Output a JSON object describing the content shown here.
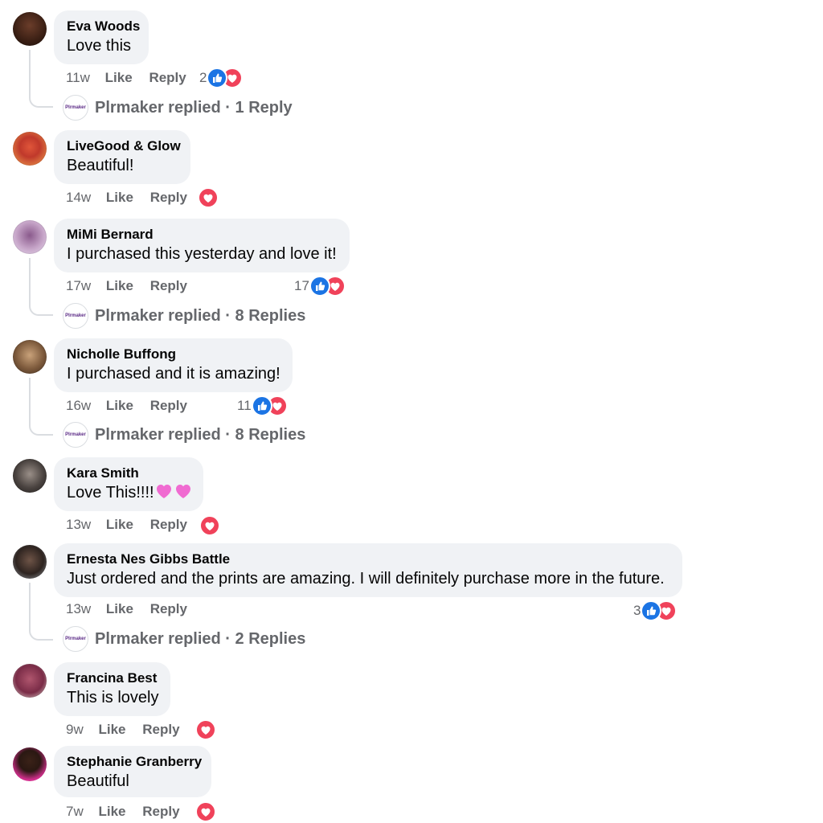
{
  "colors": {
    "like_blue": "#1b74e4",
    "love_red": "#f0425a",
    "meta_gray": "#65676b",
    "bubble_bg": "#f0f2f5"
  },
  "labels": {
    "like": "Like",
    "reply": "Reply"
  },
  "comments": [
    {
      "name": "Eva Woods",
      "text": "Love this",
      "time": "11w",
      "reaction_count": "2",
      "replied": {
        "avatar_text": "Plrmaker",
        "text": "Plrmaker replied · 1 Reply"
      }
    },
    {
      "name": "LiveGood & Glow",
      "text": "Beautiful!",
      "time": "14w"
    },
    {
      "name": "MiMi Bernard",
      "text": "I purchased this yesterday and love it!",
      "time": "17w",
      "reaction_count": "17",
      "replied": {
        "avatar_text": "Plrmaker",
        "text": "Plrmaker replied · 8 Replies"
      }
    },
    {
      "name": "Nicholle Buffong",
      "text": "I purchased and it is amazing!",
      "time": "16w",
      "reaction_count": "11",
      "replied": {
        "avatar_text": "Plrmaker",
        "text": "Plrmaker replied · 8 Replies"
      }
    },
    {
      "name": "Kara Smith",
      "text": "Love This!!!!",
      "time": "13w"
    },
    {
      "name": "Ernesta Nes Gibbs Battle",
      "text": "Just ordered and the prints are amazing. I will definitely purchase more in the future.",
      "time": "13w",
      "reaction_count": "3",
      "replied": {
        "avatar_text": "Plrmaker",
        "text": "Plrmaker replied · 2 Replies"
      }
    },
    {
      "name": "Francina Best",
      "text": "This is lovely",
      "time": "9w"
    },
    {
      "name": "Stephanie Granberry",
      "text": "Beautiful",
      "time": "7w"
    }
  ]
}
